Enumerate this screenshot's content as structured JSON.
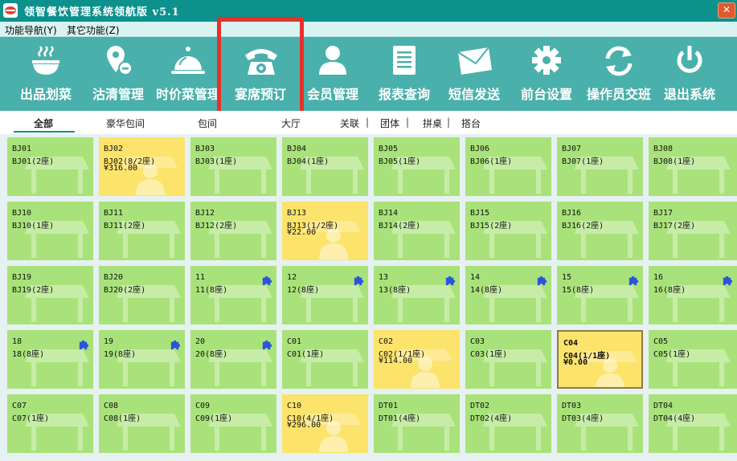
{
  "app": {
    "title": "领智餐饮管理系统领航版 v5.1"
  },
  "menu": [
    {
      "label": "功能导航(Y)"
    },
    {
      "label": "其它功能(Z)"
    }
  ],
  "toolbar": [
    {
      "label": "出品划菜",
      "icon": "bowl-icon"
    },
    {
      "label": "沽清管理",
      "icon": "location-tag-icon"
    },
    {
      "label": "时价菜管理",
      "icon": "serving-dish-icon"
    },
    {
      "label": "宴席预订",
      "icon": "telephone-icon"
    },
    {
      "label": "会员管理",
      "icon": "person-icon"
    },
    {
      "label": "报表查询",
      "icon": "report-icon"
    },
    {
      "label": "短信发送",
      "icon": "envelope-icon"
    },
    {
      "label": "前台设置",
      "icon": "gear-icon"
    },
    {
      "label": "操作员交班",
      "icon": "refresh-icon"
    },
    {
      "label": "退出系统",
      "icon": "power-icon"
    }
  ],
  "filters": [
    "全部",
    "豪华包间",
    "包间",
    "大厅",
    "关联",
    "团体",
    "拼桌",
    "搭台"
  ],
  "selected_filter": "全部",
  "colors": {
    "titlebar": "#0c918c",
    "toolbar": "#4ab0ab",
    "free_table": "#a9e27a",
    "occupied_table": "#fce36b",
    "highlight": "#e8312a"
  },
  "tables": [
    {
      "code": "BJ01",
      "seats": "BJ01(2座)",
      "amount": "",
      "status": "free"
    },
    {
      "code": "BJ02",
      "seats": "BJ02(8/2座)",
      "amount": "¥316.00",
      "status": "occupied"
    },
    {
      "code": "BJ03",
      "seats": "BJ03(1座)",
      "amount": "",
      "status": "free"
    },
    {
      "code": "BJ04",
      "seats": "BJ04(1座)",
      "amount": "",
      "status": "free"
    },
    {
      "code": "BJ05",
      "seats": "BJ05(1座)",
      "amount": "",
      "status": "free"
    },
    {
      "code": "BJ06",
      "seats": "BJ06(1座)",
      "amount": "",
      "status": "free"
    },
    {
      "code": "BJ07",
      "seats": "BJ07(1座)",
      "amount": "",
      "status": "free"
    },
    {
      "code": "BJ08",
      "seats": "BJ08(1座)",
      "amount": "",
      "status": "free"
    },
    {
      "code": "BJ10",
      "seats": "BJ10(1座)",
      "amount": "",
      "status": "free"
    },
    {
      "code": "BJ11",
      "seats": "BJ11(2座)",
      "amount": "",
      "status": "free"
    },
    {
      "code": "BJ12",
      "seats": "BJ12(2座)",
      "amount": "",
      "status": "free"
    },
    {
      "code": "BJ13",
      "seats": "BJ13(1/2座)",
      "amount": "¥22.00",
      "status": "occupied"
    },
    {
      "code": "BJ14",
      "seats": "BJ14(2座)",
      "amount": "",
      "status": "free"
    },
    {
      "code": "BJ15",
      "seats": "BJ15(2座)",
      "amount": "",
      "status": "free"
    },
    {
      "code": "BJ16",
      "seats": "BJ16(2座)",
      "amount": "",
      "status": "free"
    },
    {
      "code": "BJ17",
      "seats": "BJ17(2座)",
      "amount": "",
      "status": "free"
    },
    {
      "code": "BJ19",
      "seats": "BJ19(2座)",
      "amount": "",
      "status": "free"
    },
    {
      "code": "BJ20",
      "seats": "BJ20(2座)",
      "amount": "",
      "status": "free"
    },
    {
      "code": "11",
      "seats": "11(8座)",
      "amount": "",
      "status": "free",
      "badge": "puzzle-icon"
    },
    {
      "code": "12",
      "seats": "12(8座)",
      "amount": "",
      "status": "free",
      "badge": "puzzle-icon"
    },
    {
      "code": "13",
      "seats": "13(8座)",
      "amount": "",
      "status": "free",
      "badge": "puzzle-icon"
    },
    {
      "code": "14",
      "seats": "14(8座)",
      "amount": "",
      "status": "free",
      "badge": "puzzle-icon"
    },
    {
      "code": "15",
      "seats": "15(8座)",
      "amount": "",
      "status": "free",
      "badge": "puzzle-icon"
    },
    {
      "code": "16",
      "seats": "16(8座)",
      "amount": "",
      "status": "free",
      "badge": "puzzle-icon"
    },
    {
      "code": "18",
      "seats": "18(8座)",
      "amount": "",
      "status": "free",
      "badge": "puzzle-icon"
    },
    {
      "code": "19",
      "seats": "19(8座)",
      "amount": "",
      "status": "free",
      "badge": "puzzle-icon"
    },
    {
      "code": "20",
      "seats": "20(8座)",
      "amount": "",
      "status": "free",
      "badge": "puzzle-icon"
    },
    {
      "code": "C01",
      "seats": "C01(1座)",
      "amount": "",
      "status": "free"
    },
    {
      "code": "C02",
      "seats": "C02(1/1座)",
      "amount": "¥114.00",
      "status": "occupied"
    },
    {
      "code": "C03",
      "seats": "C03(1座)",
      "amount": "",
      "status": "free"
    },
    {
      "code": "C04",
      "seats": "C04(1/1座)",
      "amount": "¥0.00",
      "status": "selected"
    },
    {
      "code": "C05",
      "seats": "C05(1座)",
      "amount": "",
      "status": "free"
    },
    {
      "code": "C07",
      "seats": "C07(1座)",
      "amount": "",
      "status": "free"
    },
    {
      "code": "C08",
      "seats": "C08(1座)",
      "amount": "",
      "status": "free"
    },
    {
      "code": "C09",
      "seats": "C09(1座)",
      "amount": "",
      "status": "free"
    },
    {
      "code": "C10",
      "seats": "C10(4/1座)",
      "amount": "¥296.00",
      "status": "occupied"
    },
    {
      "code": "DT01",
      "seats": "DT01(4座)",
      "amount": "",
      "status": "free"
    },
    {
      "code": "DT02",
      "seats": "DT02(4座)",
      "amount": "",
      "status": "free"
    },
    {
      "code": "DT03",
      "seats": "DT03(4座)",
      "amount": "",
      "status": "free"
    },
    {
      "code": "DT04",
      "seats": "DT04(4座)",
      "amount": "",
      "status": "free"
    }
  ]
}
